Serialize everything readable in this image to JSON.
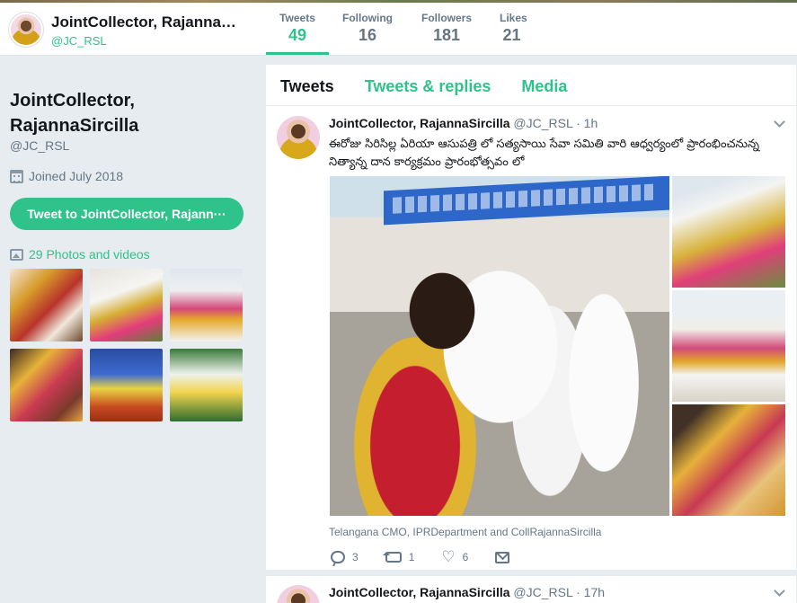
{
  "header": {
    "name": "JointCollector, Rajanna…",
    "handle": "@JC_RSL",
    "stats": [
      {
        "label": "Tweets",
        "value": "49"
      },
      {
        "label": "Following",
        "value": "16"
      },
      {
        "label": "Followers",
        "value": "181"
      },
      {
        "label": "Likes",
        "value": "21"
      }
    ]
  },
  "profile": {
    "name_line1": "JointCollector,",
    "name_line2": "RajannaSircilla",
    "handle": "@JC_RSL",
    "joined": "Joined July 2018",
    "tweet_to_label": "Tweet to JointCollector, Rajann···",
    "photos_label": "29 Photos and videos"
  },
  "tabs": [
    "Tweets",
    "Tweets & replies",
    "Media"
  ],
  "tweets": [
    {
      "name": "JointCollector, RajannaSircilla",
      "meta": "@JC_RSL · 1h",
      "text": "ఈరోజు సిరిసిల్ల ఏరియా ఆసుపత్రి లో సత్యసాయి సేవా సమితి వారి ఆధ్వర్యంలో ప్రారంభించనున్న నిత్యాన్న దాన కార్యక్రమం ప్రారంభోత్సవం లో",
      "credits": "Telangana CMO, IPRDepartment and CollRajannaSircilla",
      "replies": "3",
      "retweets": "1",
      "likes": "6"
    },
    {
      "name": "JointCollector, RajannaSircilla",
      "meta": "@JC_RSL · 17h"
    }
  ],
  "icons": {
    "calendar": "calendar-icon",
    "photo": "photo-icon",
    "reply": "reply-icon",
    "retweet": "retweet-icon",
    "like": "heart-icon",
    "dm": "envelope-icon",
    "more": "chevron-down-icon"
  },
  "colors": {
    "accent": "#2fc28a",
    "background": "#e6ecf0",
    "muted": "#657786"
  }
}
